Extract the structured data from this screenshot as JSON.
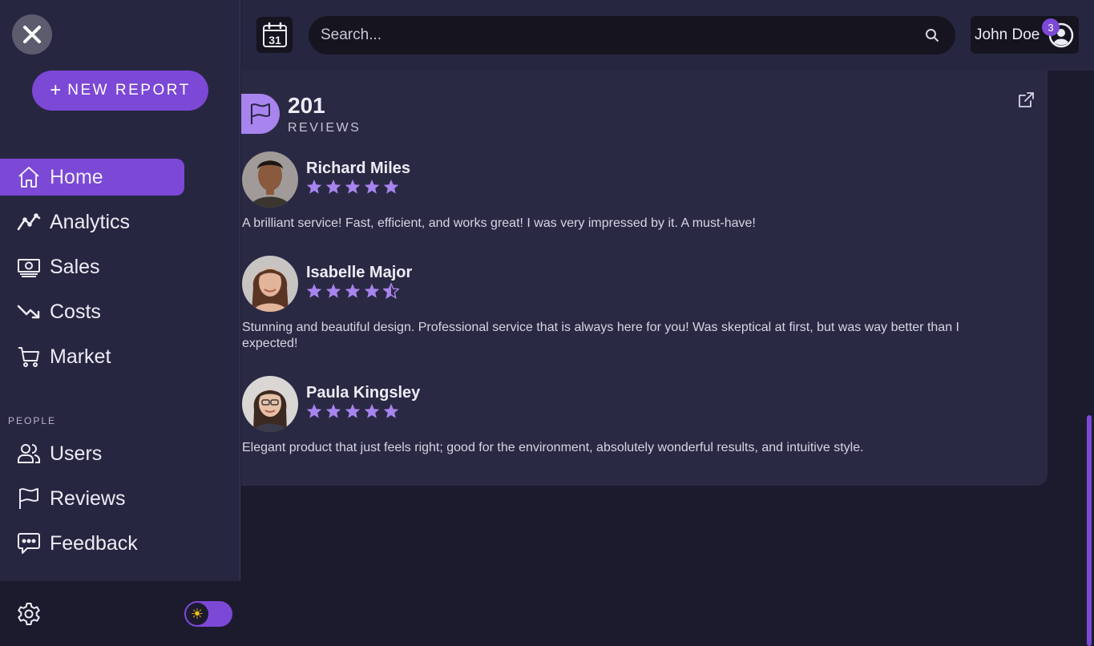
{
  "sidebar": {
    "new_report_label": "NEW REPORT",
    "nav_main": [
      {
        "label": "Home",
        "icon": "home-icon",
        "active": true
      },
      {
        "label": "Analytics",
        "icon": "trend-up-icon"
      },
      {
        "label": "Sales",
        "icon": "cash-icon"
      },
      {
        "label": "Costs",
        "icon": "trend-down-icon"
      },
      {
        "label": "Market",
        "icon": "cart-icon"
      }
    ],
    "section_people": "PEOPLE",
    "nav_people": [
      {
        "label": "Users",
        "icon": "users-icon"
      },
      {
        "label": "Reviews",
        "icon": "flag-icon"
      },
      {
        "label": "Feedback",
        "icon": "chat-icon"
      }
    ]
  },
  "topbar": {
    "calendar_day": "31",
    "search_placeholder": "Search...",
    "user_name": "John Doe",
    "notification_count": "3"
  },
  "reviews": {
    "count": "201",
    "label": "REVIEWS",
    "items": [
      {
        "name": "Richard Miles",
        "rating": 5,
        "text": "A brilliant service! Fast, efficient, and works great! I was very impressed by it. A must-have!"
      },
      {
        "name": "Isabelle Major",
        "rating": 4.5,
        "text": "Stunning and beautiful design. Professional service that is always here for you! Was skeptical at first, but was way better than I expected!"
      },
      {
        "name": "Paula Kingsley",
        "rating": 5,
        "text": "Elegant product that just feels right; good for the environment, absolutely wonderful results, and intuitive style."
      }
    ]
  },
  "colors": {
    "accent": "#7c48d6",
    "star": "#a884ee",
    "sidebar_bg": "#272641",
    "page_bg": "#1c1b2e"
  }
}
